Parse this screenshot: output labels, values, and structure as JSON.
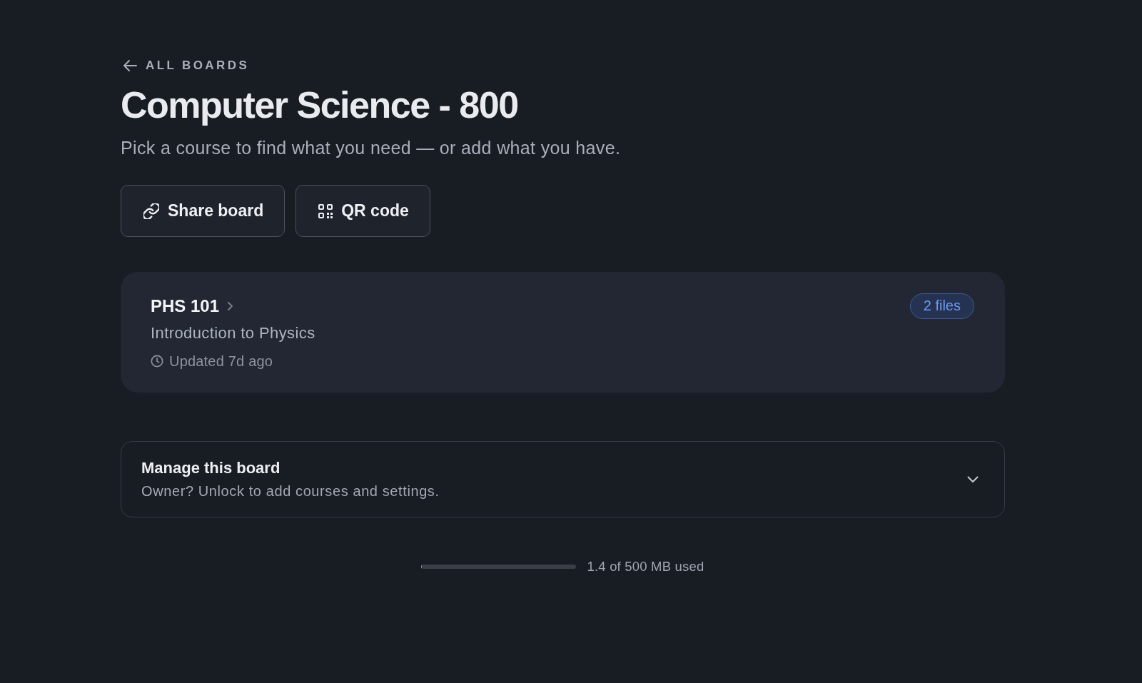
{
  "back_link": {
    "label": "ALL BOARDS"
  },
  "title": "Computer Science - 800",
  "subtitle": "Pick a course to find what you need — or add what you have.",
  "actions": [
    {
      "label": "Share board",
      "kind": "share"
    },
    {
      "label": "QR code",
      "kind": "qr"
    }
  ],
  "courses": [
    {
      "code": "PHS 101",
      "name": "Introduction to Physics",
      "updated": "Updated 7d ago",
      "files": "2 files"
    }
  ],
  "manage_panel": {
    "title": "Manage this board",
    "description": "Owner? Unlock to add courses and settings.",
    "expanded": false
  },
  "storage": {
    "level": 0.003,
    "label": "1.4 of 500 MB used"
  }
}
